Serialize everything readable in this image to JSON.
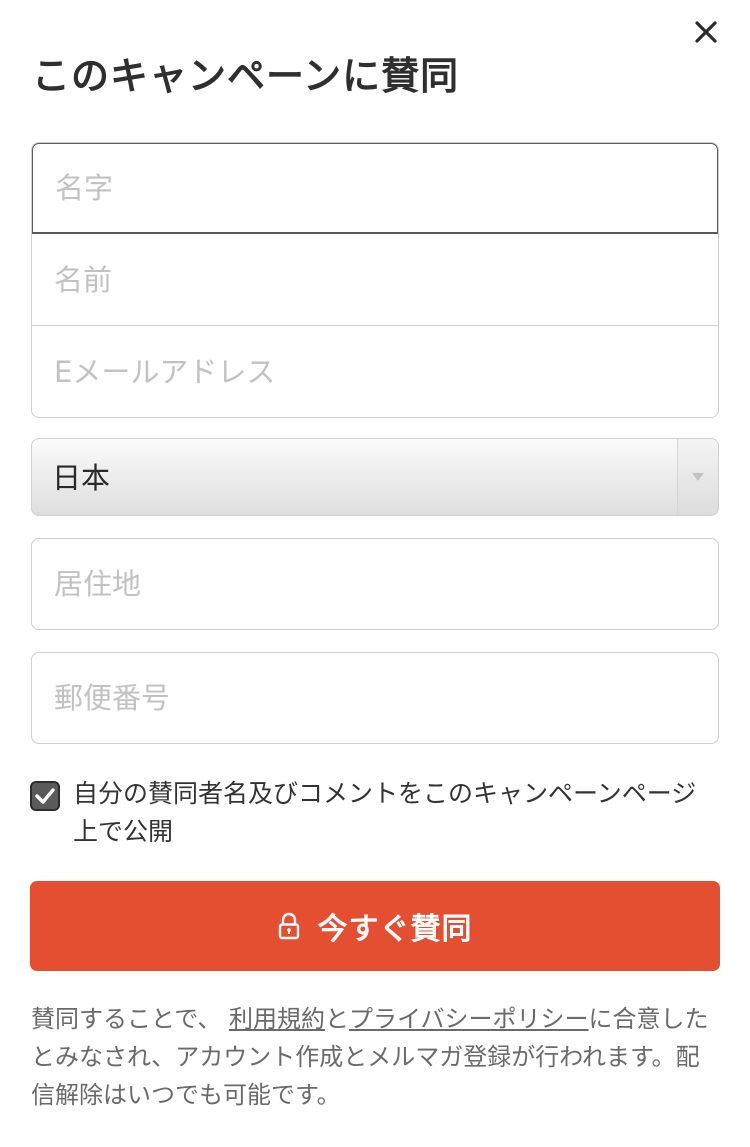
{
  "dialog": {
    "title": "このキャンペーンに賛同",
    "close_icon": "close-icon"
  },
  "form": {
    "last_name": {
      "placeholder": "名字",
      "value": ""
    },
    "first_name": {
      "placeholder": "名前",
      "value": ""
    },
    "email": {
      "placeholder": "Eメールアドレス",
      "value": ""
    },
    "country": {
      "selected": "日本",
      "arrow_icon": "triangle-down-icon"
    },
    "residence": {
      "placeholder": "居住地",
      "value": ""
    },
    "postal_code": {
      "placeholder": "郵便番号",
      "value": ""
    },
    "consent": {
      "checked": true,
      "label": "自分の賛同者名及びコメントをこのキャンペーンページ上で公開"
    },
    "submit": {
      "label": "今すぐ賛同",
      "icon": "lock-icon",
      "color": "#e44f31"
    }
  },
  "legal": {
    "prefix": "賛同することで、",
    "terms_link": "利用規約",
    "conjunction": "と",
    "privacy_link": "プライバシーポリシー",
    "suffix": "に合意したとみなされ、アカウント作成とメルマガ登録が行われます。配信解除はいつでも可能です。"
  }
}
